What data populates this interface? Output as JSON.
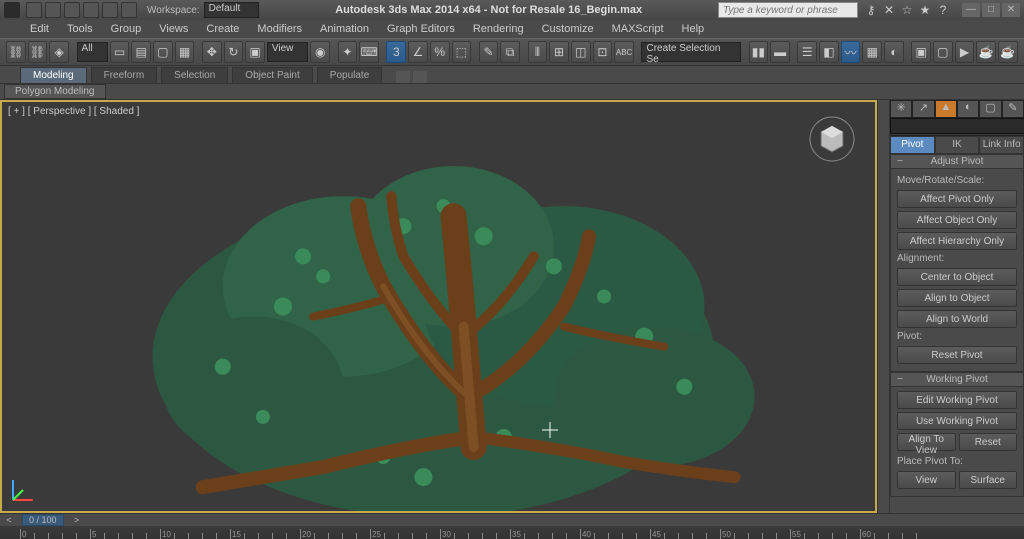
{
  "titlebar": {
    "workspace_label": "Workspace:",
    "workspace_value": "Default",
    "app_title": "Autodesk 3ds Max 2014 x64  - Not for Resale   16_Begin.max",
    "search_placeholder": "Type a keyword or phrase"
  },
  "menu": [
    "Edit",
    "Tools",
    "Group",
    "Views",
    "Create",
    "Modifiers",
    "Animation",
    "Graph Editors",
    "Rendering",
    "Customize",
    "MAXScript",
    "Help"
  ],
  "maintoolbar": {
    "all": "All",
    "view": "View",
    "three": "3",
    "create_sel": "Create Selection Se"
  },
  "ribbon": {
    "tabs": [
      "Modeling",
      "Freeform",
      "Selection",
      "Object Paint",
      "Populate"
    ],
    "active": 0
  },
  "ribbon2": {
    "tab": "Polygon Modeling"
  },
  "viewport": {
    "label": "[ + ] [ Perspective ] [ Shaded ]"
  },
  "command_panel": {
    "subtabs": [
      "Pivot",
      "IK",
      "Link Info"
    ],
    "rollouts": {
      "adjust_pivot": {
        "title": "Adjust Pivot",
        "group1": "Move/Rotate/Scale:",
        "btn1": "Affect Pivot Only",
        "btn2": "Affect Object Only",
        "btn3": "Affect Hierarchy Only",
        "group2": "Alignment:",
        "btn4": "Center to Object",
        "btn5": "Align to Object",
        "btn6": "Align to World",
        "group3": "Pivot:",
        "btn7": "Reset Pivot"
      },
      "working_pivot": {
        "title": "Working Pivot",
        "btn1": "Edit Working Pivot",
        "btn2": "Use Working Pivot",
        "btn3a": "Align To View",
        "btn3b": "Reset",
        "group1": "Place Pivot To:",
        "btn4a": "View",
        "btn4b": "Surface"
      }
    }
  },
  "timeline": {
    "frame": "0 / 100",
    "ticks": [
      0,
      5,
      10,
      15,
      20,
      25,
      30,
      35,
      40,
      45,
      50,
      55,
      60
    ]
  }
}
